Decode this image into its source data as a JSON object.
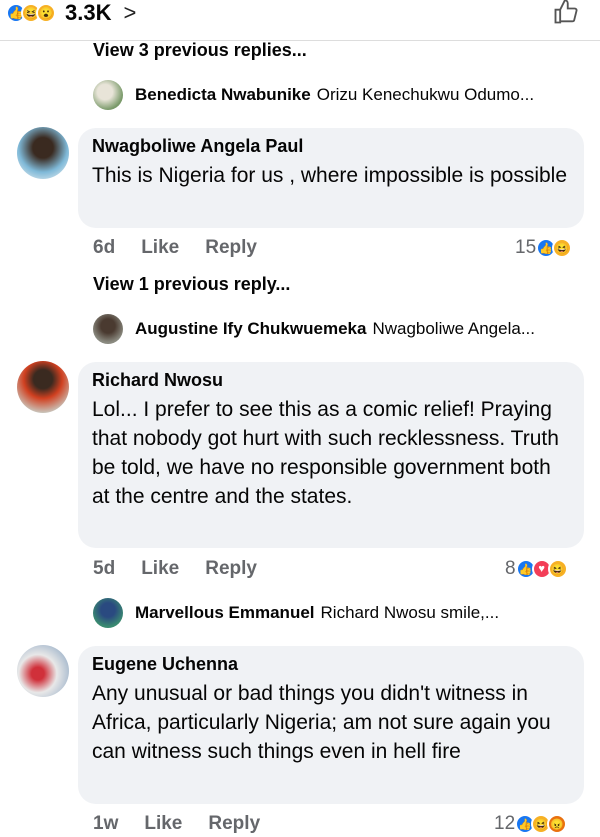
{
  "top": {
    "count": "3.3K",
    "chevron": ">",
    "like_icon": "thumbs-up-icon"
  },
  "thread1": {
    "view_previous": "View 3 previous replies...",
    "reply_name": "Benedicta Nwabunike",
    "reply_text": "Orizu Kenechukwu Odumo..."
  },
  "comment1": {
    "name": "Nwagboliwe Angela Paul",
    "text": "This is Nigeria for us , where impossible is possible",
    "time": "6d",
    "like": "Like",
    "reply": "Reply",
    "reaction_count": "15"
  },
  "thread2": {
    "view_previous": "View 1 previous reply...",
    "reply_name": "Augustine Ify Chukwuemeka",
    "reply_text": "Nwagboliwe Angela..."
  },
  "comment2": {
    "name": "Richard Nwosu",
    "text": "Lol... I prefer to see this as a comic relief! Praying that nobody got hurt with such recklessness. Truth be told, we have no responsible government both at the centre and the states.",
    "time": "5d",
    "like": "Like",
    "reply": "Reply",
    "reaction_count": "8"
  },
  "thread3": {
    "reply_name": "Marvellous Emmanuel",
    "reply_text": "Richard Nwosu smile,..."
  },
  "comment3": {
    "name": "Eugene Uchenna",
    "text": "Any unusual or bad things you didn't witness in Africa,  particularly Nigeria; am not sure again you can witness such things even in hell fire",
    "time": "1w",
    "like": "Like",
    "reply": "Reply",
    "reaction_count": "12"
  },
  "colors": {
    "like": "#1877f2",
    "haha": "#f7b125",
    "love": "#f33e58",
    "angry": "#e9710f",
    "bubble": "#f0f2f5",
    "meta": "#65676b"
  }
}
